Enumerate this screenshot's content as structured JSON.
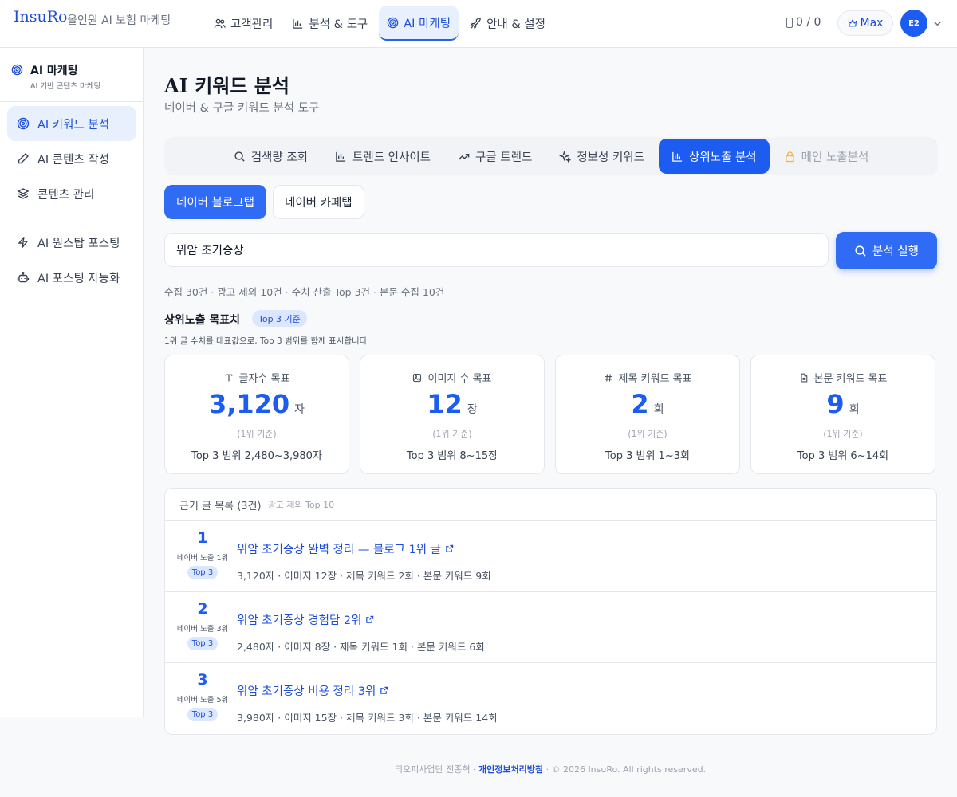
{
  "header": {
    "logo": "InsuRo",
    "logo_sub": "올인원 AI 보험 마케팅",
    "nav": [
      {
        "label": "고객관리",
        "icon": "users-icon"
      },
      {
        "label": "분석 & 도구",
        "icon": "bar-chart-icon"
      },
      {
        "label": "AI 마케팅",
        "icon": "target-icon"
      },
      {
        "label": "안내 & 설정",
        "icon": "rocket-icon"
      }
    ],
    "active_nav": "AI 마케팅",
    "credits": "0 / 0",
    "plan": "Max",
    "avatar": "E2"
  },
  "sidebar": {
    "title": "AI 마케팅",
    "subtitle": "AI 기반 콘텐츠 마케팅",
    "items": [
      {
        "label": "AI 키워드 분석",
        "icon": "target-icon"
      },
      {
        "label": "AI 콘텐츠 작성",
        "icon": "pencil-icon"
      },
      {
        "label": "콘텐츠 관리",
        "icon": "layers-icon"
      },
      {
        "label": "AI 원스탑 포스팅",
        "icon": "lightning-icon"
      },
      {
        "label": "AI 포스팅 자동화",
        "icon": "robot-icon"
      }
    ]
  },
  "main": {
    "title": "AI 키워드 분석",
    "subtitle": "네이버 & 구글 키워드 분석 도구",
    "tabs": [
      {
        "label": "검색량 조회",
        "icon": "search-icon"
      },
      {
        "label": "트렌드 인사이트",
        "icon": "bar-chart-icon"
      },
      {
        "label": "구글 트렌드",
        "icon": "trend-up-icon"
      },
      {
        "label": "정보성 키워드",
        "icon": "sparkle-icon"
      },
      {
        "label": "상위노출 분석",
        "icon": "bar-chart-icon"
      },
      {
        "label": "메인 노출분석",
        "icon": "lock-icon"
      }
    ],
    "subtabs": [
      "네이버 블로그탭",
      "네이버 카페탭"
    ],
    "search": {
      "value": "위암 초기증상",
      "placeholder": ""
    },
    "run_button": "분석 실행",
    "stats_line": "수집 30건 · 광고 제외 10건 · 수치 산출 Top 3건 · 본문 수집 10건",
    "target": {
      "title": "상위노출 목표치",
      "badge": "Top 3 기준",
      "note": "1위 글 수치를 대표값으로, Top 3 범위를 함께 표시합니다"
    },
    "cards": [
      {
        "label": "글자수 목표",
        "icon": "text-icon",
        "value": "3,120",
        "unit": "자",
        "rank": "(1위 기준)",
        "range": "Top 3 범위 2,480~3,980자"
      },
      {
        "label": "이미지 수 목표",
        "icon": "image-icon",
        "value": "12",
        "unit": "장",
        "rank": "(1위 기준)",
        "range": "Top 3 범위 8~15장"
      },
      {
        "label": "제목 키워드 목표",
        "icon": "hash-icon",
        "value": "2",
        "unit": "회",
        "rank": "(1위 기준)",
        "range": "Top 3 범위 1~3회"
      },
      {
        "label": "본문 키워드 목표",
        "icon": "file-icon",
        "value": "9",
        "unit": "회",
        "rank": "(1위 기준)",
        "range": "Top 3 범위 6~14회"
      }
    ],
    "list": {
      "title": "근거 글 목록 (3건)",
      "subtitle": "광고 제외 Top 10",
      "rows": [
        {
          "num": "1",
          "rank": "네이버 노출 1위",
          "badge": "Top 3",
          "title": "위암 초기증상 완벽 정리 — 블로그 1위 글",
          "meta": "3,120자 · 이미지 12장 · 제목 키워드 2회 · 본문 키워드 9회"
        },
        {
          "num": "2",
          "rank": "네이버 노출 3위",
          "badge": "Top 3",
          "title": "위암 초기증상 경험담 2위",
          "meta": "2,480자 · 이미지 8장 · 제목 키워드 1회 · 본문 키워드 6회"
        },
        {
          "num": "3",
          "rank": "네이버 노출 5위",
          "badge": "Top 3",
          "title": "위암 초기증상 비용 정리 3위",
          "meta": "3,980자 · 이미지 15장 · 제목 키워드 3회 · 본문 키워드 14회"
        }
      ]
    }
  },
  "footer": {
    "company": "티오피사업단 전종혁",
    "privacy": "개인정보처리방침",
    "copyright": "© 2026 InsuRo. All rights reserved."
  },
  "colors": {
    "primary": "#1d5cf0",
    "accent_light": "#e8f0fe",
    "text": "#1f2937"
  }
}
